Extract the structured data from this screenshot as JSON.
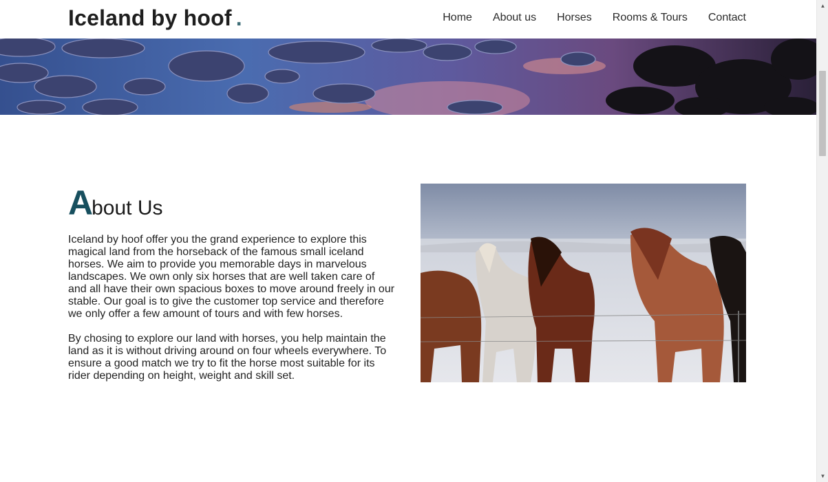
{
  "header": {
    "brand": "Iceland by hoof",
    "brand_dot": ".",
    "nav": [
      {
        "label": "Home"
      },
      {
        "label": "About us"
      },
      {
        "label": "Horses"
      },
      {
        "label": "Rooms & Tours"
      },
      {
        "label": "Contact"
      }
    ]
  },
  "banner": {
    "icon": "landscape-banner-image"
  },
  "about": {
    "title_initial": "A",
    "title_rest": "bout Us",
    "paragraphs": [
      "Iceland by hoof offer you the grand experience to explore this magical land from the horseback of the famous small iceland horses. We aim to provide you memorable days in marvelous landscapes. We own only six horses that are well taken care of and all have their own spacious boxes to move around freely in our stable. Our goal is to give the customer top service and therefore we only offer a few amount of tours and with few horses.",
      "By chosing to explore our land with horses, you help maintain the land as it is without driving around on four wheels everywhere. To ensure a good match we try to fit the horse most suitable for its rider depending on height, weight and skill set."
    ],
    "photo_icon": "horses-photo"
  },
  "scrollbar": {
    "up_icon": "▲",
    "down_icon": "▼"
  },
  "colors": {
    "accent": "#174f5e",
    "brand_dot": "#3f6e78",
    "text": "#222222"
  }
}
